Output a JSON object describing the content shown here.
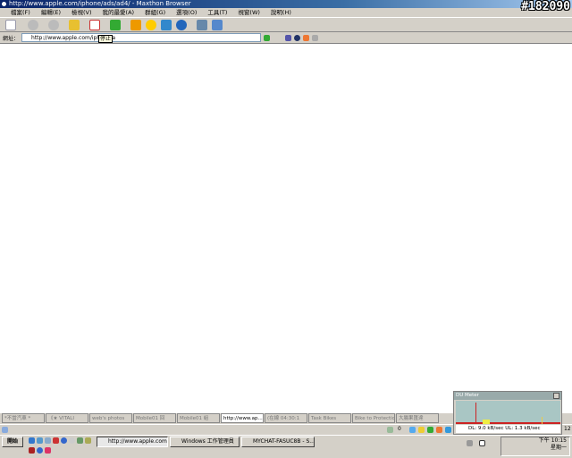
{
  "window": {
    "title": "http://www.apple.com/iphone/ads/ad4/ - Maxthon Browser",
    "watermark": "#182090"
  },
  "menu": [
    "檔案(F)",
    "編輯(E)",
    "檢視(V)",
    "我的最愛(A)",
    "群組(G)",
    "選項(O)",
    "工具(T)",
    "視窗(W)",
    "說明(H)"
  ],
  "address": {
    "label": "網址：",
    "value": "http://www.apple.com/iphone/a",
    "tooltip": "停止"
  },
  "tabs": [
    {
      "label": "*不當汽車 *"
    },
    {
      "label": "《★ VITALI"
    },
    {
      "label": "web's photos"
    },
    {
      "label": "Mobile01 回"
    },
    {
      "label": "Mobile01 組"
    },
    {
      "label": "http://www.ap...",
      "active": true
    },
    {
      "label": "(在線 04:30:1"
    },
    {
      "label": "Task Bikes"
    },
    {
      "label": "Bike to Protection"
    },
    {
      "label": "大腸果匯達"
    }
  ],
  "status": {
    "popup_count": "0",
    "page_number": "12"
  },
  "du_meter": {
    "title": "DU Meter",
    "reading": "DL: 9.0 kB/sec  UL: 1.3 kB/sec"
  },
  "taskbar": {
    "start": "開始",
    "tasks": [
      {
        "label": "http://www.apple.com/iph...",
        "active": true
      },
      {
        "label": "Windows 工作管理員"
      },
      {
        "label": "MYCHAT-FASUC8B - S..."
      }
    ],
    "clock": "下午 10:15",
    "day": "星期一"
  }
}
